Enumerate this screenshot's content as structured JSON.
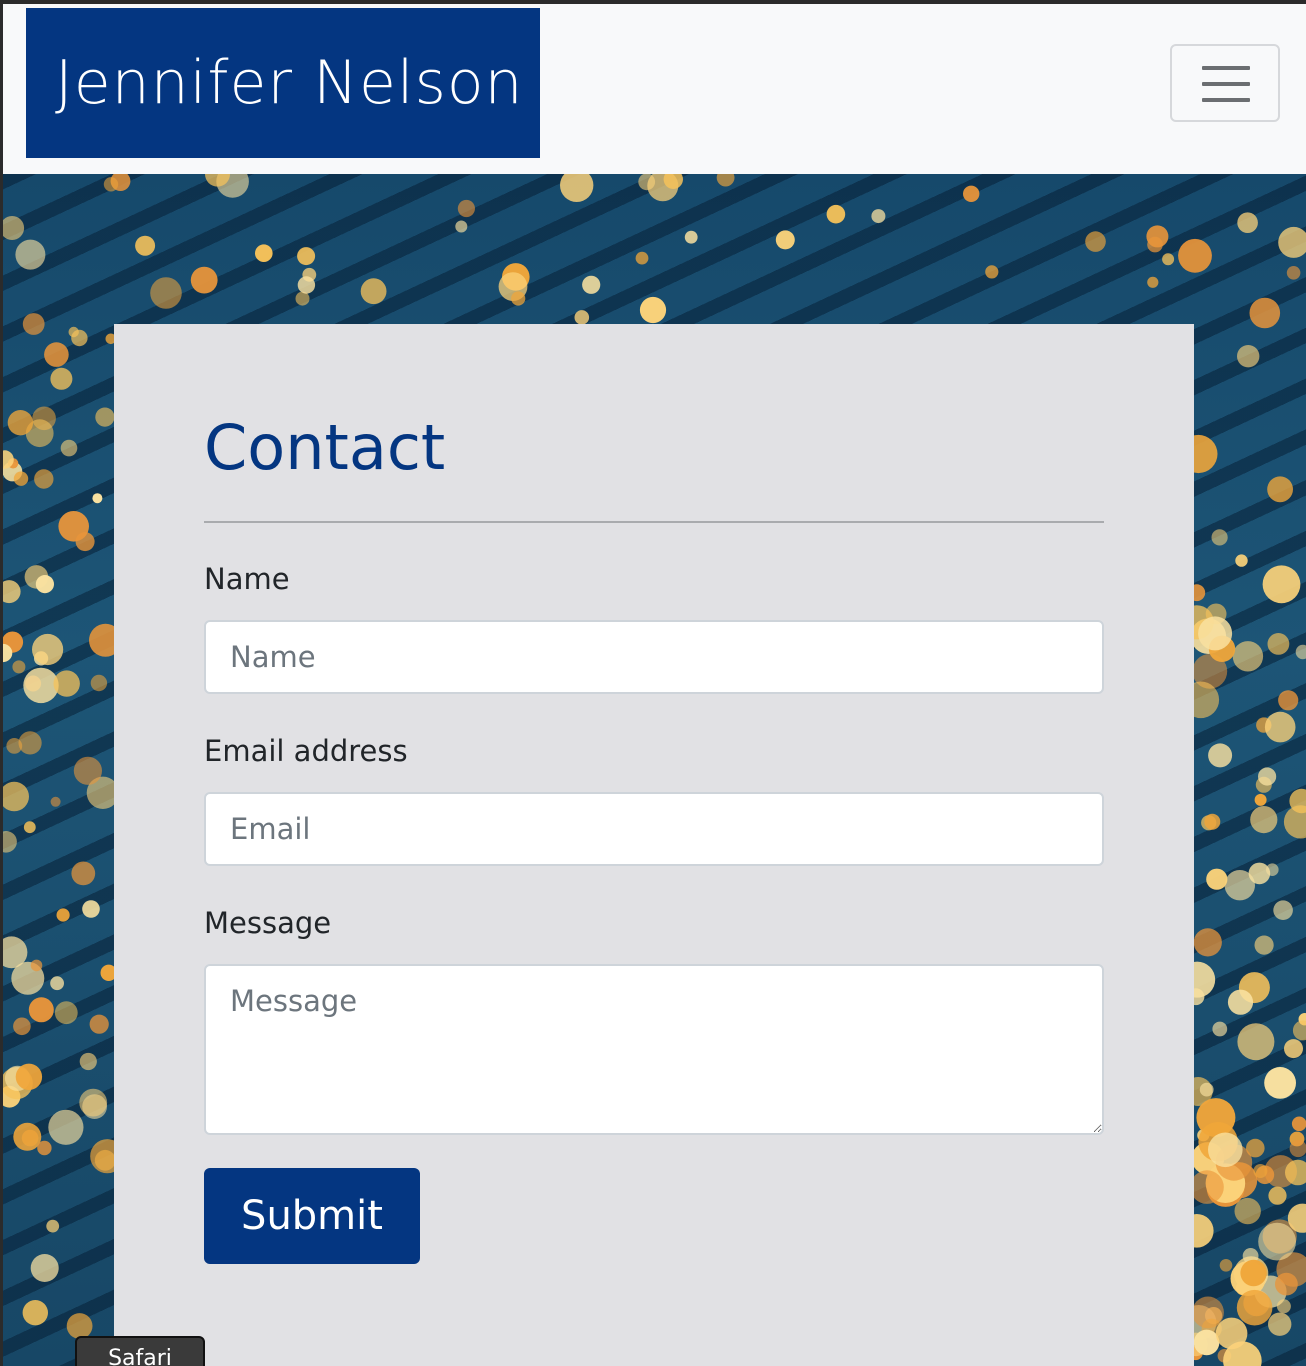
{
  "navbar": {
    "brand": "Jennifer Nelson",
    "toggler_icon": "hamburger-menu-icon"
  },
  "contact": {
    "title": "Contact",
    "name_label": "Name",
    "name_placeholder": "Name",
    "email_label": "Email address",
    "email_placeholder": "Email",
    "message_label": "Message",
    "message_placeholder": "Message",
    "submit_label": "Submit"
  },
  "taskbar": {
    "app_label": "Safari"
  },
  "colors": {
    "brand": "#043681",
    "navbar_bg": "#f8f9fa",
    "card_bg": "#e1e1e4",
    "hero_bg": "#1d5576",
    "bokeh": "#f2b04a"
  }
}
